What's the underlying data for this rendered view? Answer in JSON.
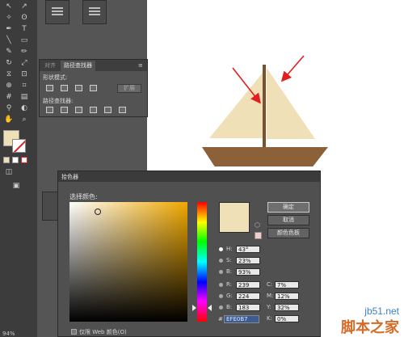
{
  "pathfinder": {
    "tabs": [
      "对齐",
      "路径查找器"
    ],
    "shape_modes_label": "形状模式:",
    "pathfinders_label": "路径查找器:",
    "expand_label": "扩展"
  },
  "colors": {
    "fill": "#EFE0B7",
    "sail": "#EFE0B7",
    "mast": "#7A5230",
    "hull": "#8C6039",
    "arrow": "#E02020"
  },
  "picker": {
    "title": "拾色器",
    "select_label": "选择颜色:",
    "ok_label": "确定",
    "cancel_label": "取消",
    "swatches_label": "颜色色板",
    "fields": {
      "H": {
        "label": "H:",
        "value": "43°"
      },
      "S": {
        "label": "S:",
        "value": "23%"
      },
      "B": {
        "label": "B:",
        "value": "93%"
      },
      "R": {
        "label": "R:",
        "value": "239"
      },
      "G": {
        "label": "G:",
        "value": "224"
      },
      "Bl": {
        "label": "B:",
        "value": "183"
      },
      "C": {
        "label": "C:",
        "value": "7%"
      },
      "M": {
        "label": "M:",
        "value": "12%"
      },
      "Y": {
        "label": "Y:",
        "value": "32%"
      },
      "K": {
        "label": "K:",
        "value": "0%"
      }
    },
    "hex_prefix": "#",
    "hex": "EFE0B7",
    "web_only_label": "仅限 Web 颜色(O)"
  },
  "status": {
    "zoom": "94%"
  },
  "watermark": {
    "url": "jb51.net",
    "name": "脚本之家"
  }
}
